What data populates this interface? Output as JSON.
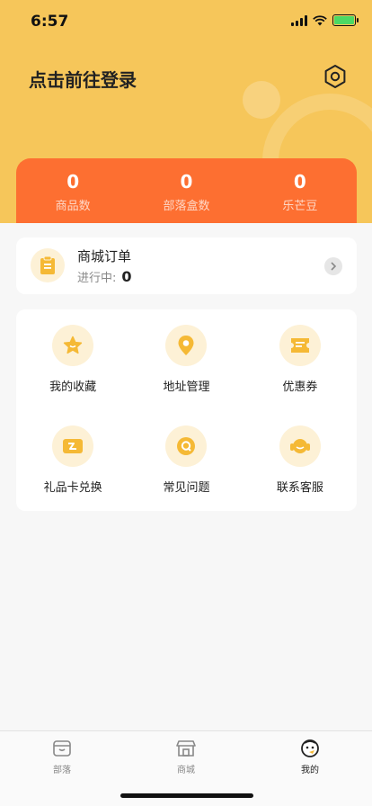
{
  "status_bar": {
    "time": "6:57"
  },
  "header": {
    "login_prompt": "点击前往登录",
    "settings_icon": "hexagon-gear-icon"
  },
  "stats": [
    {
      "value": "0",
      "label": "商品数"
    },
    {
      "value": "0",
      "label": "部落盒数"
    },
    {
      "value": "0",
      "label": "乐芒豆"
    }
  ],
  "order": {
    "title": "商城订单",
    "status_label": "进行中:",
    "count": "0"
  },
  "services": [
    {
      "label": "我的收藏",
      "icon": "star-icon"
    },
    {
      "label": "地址管理",
      "icon": "location-pin-icon"
    },
    {
      "label": "优惠券",
      "icon": "coupon-icon"
    },
    {
      "label": "礼品卡兑换",
      "icon": "gift-card-icon"
    },
    {
      "label": "常见问题",
      "icon": "question-icon"
    },
    {
      "label": "联系客服",
      "icon": "headset-icon"
    }
  ],
  "tabbar": {
    "items": [
      {
        "label": "部落",
        "icon": "box-icon"
      },
      {
        "label": "商城",
        "icon": "shop-icon"
      },
      {
        "label": "我的",
        "icon": "mascot-face-icon"
      }
    ],
    "active_index": 2
  },
  "colors": {
    "header_bg": "#f6c65a",
    "accent_orange": "#fd6f31",
    "icon_yellow": "#f5b935",
    "icon_circle_bg": "#fdf1d6"
  }
}
